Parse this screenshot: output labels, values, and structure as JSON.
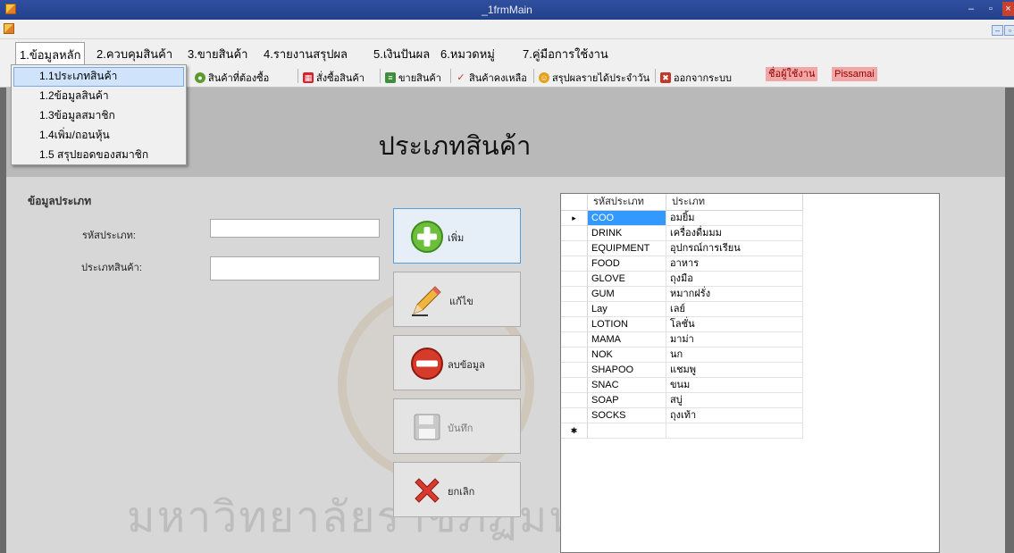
{
  "window": {
    "title": "_1frmMain",
    "min": "–",
    "max": "▫",
    "close": "×"
  },
  "menu": [
    {
      "label": "1.ข้อมูลหลัก"
    },
    {
      "label": "2.ควบคุมสินค้า"
    },
    {
      "label": "3.ขายสินค้า"
    },
    {
      "label": "4.รายงานสรุปผล"
    },
    {
      "label": "5.เงินปันผล"
    },
    {
      "label": "6.หมวดหมู่"
    },
    {
      "label": "7.คู่มือการใช้งาน"
    }
  ],
  "dropdown": [
    {
      "label": "1.1ประเภทสินค้า"
    },
    {
      "label": "1.2ข้อมูลสินค้า"
    },
    {
      "label": "1.3ข้อมูลสมาชิก"
    },
    {
      "label": "1.4เพิ่ม/ถอนหุ้น"
    },
    {
      "label": "1.5 สรุปยอดของสมาชิก"
    }
  ],
  "toolbar": {
    "items": [
      {
        "label": "สินค้าที่ต้องซื้อ",
        "icon": "leaf-icon"
      },
      {
        "label": "สั่งซื้อสินค้า",
        "icon": "calendar-icon"
      },
      {
        "label": "ขายสินค้า",
        "icon": "cart-icon"
      },
      {
        "label": "สินค้าคงเหลือ",
        "icon": "check-icon"
      },
      {
        "label": "สรุปผลรายได้ประจำวัน",
        "icon": "people-icon"
      },
      {
        "label": "ออกจากระบบ",
        "icon": "exit-icon"
      }
    ],
    "user_caption": "ชื่อผู้ใช้งาน",
    "user_name": "Pissamai",
    "user_color": "#f4a6a6"
  },
  "form": {
    "title": "ประเภทสินค้า",
    "group_title": "ข้อมูลประเภท",
    "code_label": "รหัสประเภท:",
    "code_value": "",
    "type_label": "ประเภทสินค้า:",
    "type_value": "",
    "buttons": {
      "add": "เพิ่ม",
      "edit": "แก้ไข",
      "delete": "ลบข้อมูล",
      "save": "บันทึก",
      "cancel": "ยกเลิก"
    },
    "watermark": "มหาวิทยาลัยราชภัฏมหาสารคาม"
  },
  "grid": {
    "columns": [
      "รหัสประเภท",
      "ประเภท"
    ],
    "rows": [
      [
        "COO",
        "อมยิ้ม"
      ],
      [
        "DRINK",
        "เครื่องดื่มมม"
      ],
      [
        "EQUIPMENT",
        "อุปกรณ์การเรียน"
      ],
      [
        "FOOD",
        "อาหาร"
      ],
      [
        "GLOVE",
        "ถุงมือ"
      ],
      [
        "GUM",
        "หมากฝรั่ง"
      ],
      [
        "Lay",
        "เลย์"
      ],
      [
        "LOTION",
        "โลชั่น"
      ],
      [
        "MAMA",
        "มาม่า"
      ],
      [
        "NOK",
        "นก"
      ],
      [
        "SHAPOO",
        "แชมพู"
      ],
      [
        "SNAC",
        "ขนม"
      ],
      [
        "SOAP",
        "สบู่"
      ],
      [
        "SOCKS",
        "ถุงเท้า"
      ]
    ],
    "current_marker": "▸",
    "new_row_marker": "✱",
    "selected_color": "#3399ff"
  }
}
